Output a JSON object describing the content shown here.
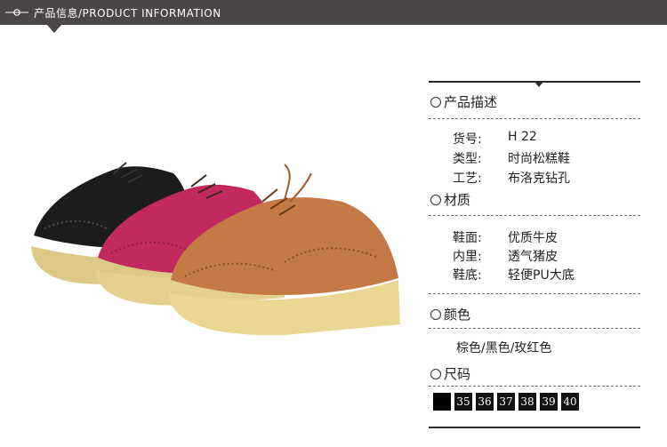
{
  "header": {
    "title": "产品信息/PRODUCT INFORMATION",
    "bg_color": "#4a4645"
  },
  "product_image": {
    "icon": "shoes-photo",
    "colors": [
      "#1c1c1c",
      "#c2295f",
      "#c57a45"
    ]
  },
  "description": {
    "title": "产品描述",
    "rows": [
      {
        "label": "货号:",
        "value": "H 22"
      },
      {
        "label": "类型:",
        "value": "时尚松糕鞋"
      },
      {
        "label": "工艺:",
        "value": "布洛克钻孔"
      }
    ]
  },
  "material": {
    "title": "材质",
    "rows": [
      {
        "label": "鞋面:",
        "value": "优质牛皮"
      },
      {
        "label": "内里:",
        "value": "透气猪皮"
      },
      {
        "label": "鞋底:",
        "value": "轻便PU大底"
      }
    ]
  },
  "color_section": {
    "title": "颜色",
    "value": "棕色/黑色/玫红色"
  },
  "size_section": {
    "title": "尺码",
    "sizes": [
      "35",
      "36",
      "37",
      "38",
      "39",
      "40"
    ]
  }
}
